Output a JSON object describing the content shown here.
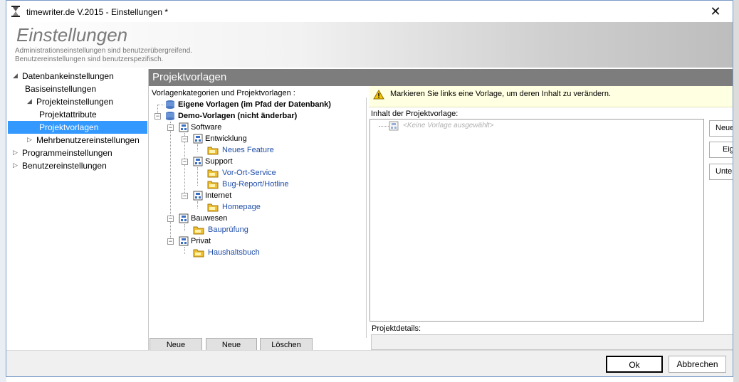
{
  "window": {
    "title": "timewriter.de V.2015 - Einstellungen *",
    "close_glyph": "✕"
  },
  "header": {
    "title": "Einstellungen",
    "line1": "Administrationseinstellungen sind benutzerübergreifend.",
    "line2": "Benutzereinstellungen sind benutzerspezifisch."
  },
  "nav": {
    "items": [
      {
        "label": "Datenbankeinstellungen",
        "arrow": "◢"
      },
      {
        "label": "Basiseinstellungen"
      },
      {
        "label": "Projekteinstellungen",
        "arrow": "◢"
      },
      {
        "label": "Projektattribute"
      },
      {
        "label": "Projektvorlagen",
        "selected": true
      },
      {
        "label": "Mehrbenutzereinstellungen",
        "arrow": "▷"
      },
      {
        "label": "Programmeinstellungen",
        "arrow": "▷"
      },
      {
        "label": "Benutzereinstellungen",
        "arrow": "▷"
      }
    ]
  },
  "panel": {
    "title": "Projektvorlagen",
    "tree_label": "Vorlagenkategorien und Projektvorlagen :",
    "tree": [
      {
        "label": "Eigene Vorlagen (im Pfad der Datenbank)"
      },
      {
        "label": "Demo-Vorlagen (nicht änderbar)"
      },
      {
        "label": "Software"
      },
      {
        "label": "Entwicklung"
      },
      {
        "label": "Neues Feature"
      },
      {
        "label": "Support"
      },
      {
        "label": "Vor-Ort-Service"
      },
      {
        "label": "Bug-Report/Hotline"
      },
      {
        "label": "Internet"
      },
      {
        "label": "Homepage"
      },
      {
        "label": "Bauwesen"
      },
      {
        "label": "Bauprüfung"
      },
      {
        "label": "Privat"
      },
      {
        "label": "Haushaltsbuch"
      }
    ],
    "tree_buttons": {
      "new_category": "Neue",
      "new_template": "Neue",
      "delete": "Löschen"
    },
    "info_text": "Markieren Sie links eine Vorlage, um deren Inhalt zu verändern.",
    "content_label": "Inhalt der Projektvorlage:",
    "content_placeholder": "<Keine Vorlage ausgewählt>",
    "side_buttons": [
      "Neue",
      "Eige",
      "Unte"
    ],
    "details_label": "Projektdetails:"
  },
  "footer": {
    "ok": "Ok",
    "cancel": "Abbrechen"
  },
  "colors": {
    "selection": "#3399ff",
    "panel_header": "#7d7d7d",
    "link_blue": "#1f4ea8",
    "info_bg": "#ffffe1"
  }
}
